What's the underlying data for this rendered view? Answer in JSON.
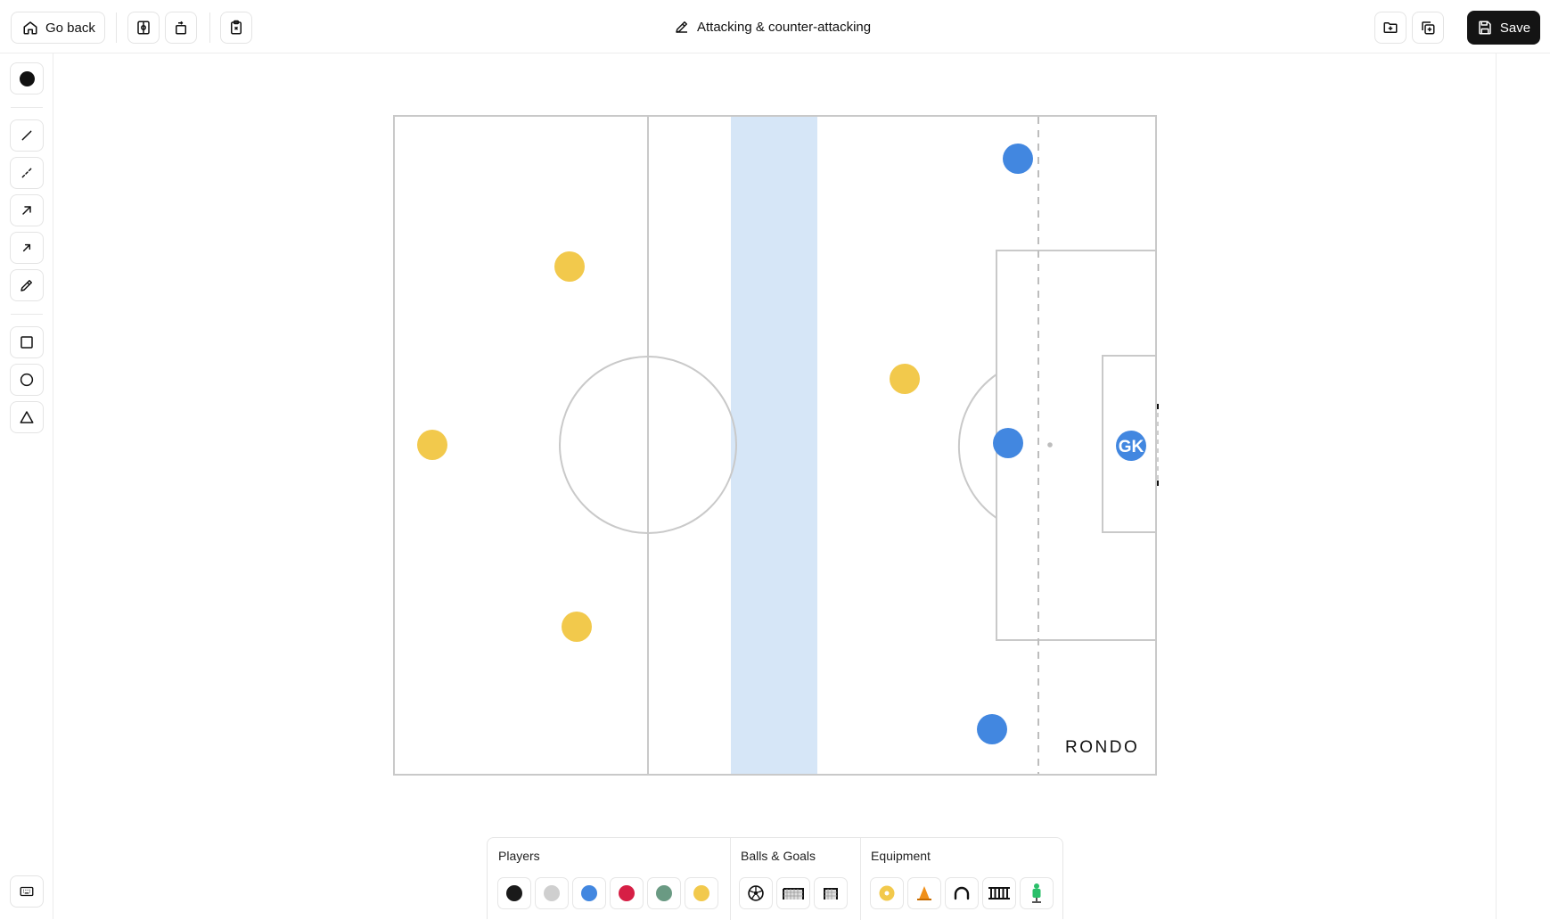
{
  "header": {
    "go_back_label": "Go back",
    "title": "Attacking & counter-attacking",
    "save_label": "Save"
  },
  "pitch": {
    "logo": "RONDO",
    "goalkeeper_label": "GK",
    "colors": {
      "team_yellow": "#f2c94c",
      "team_blue": "#4287e0",
      "zone_highlight": "#d6e6f7",
      "lines": "#c9c9c9"
    }
  },
  "palette": {
    "players_label": "Players",
    "balls_goals_label": "Balls & Goals",
    "equipment_label": "Equipment",
    "player_colors": [
      "#1a1a1a",
      "#cfcfcf",
      "#4287e0",
      "#d61f45",
      "#6a9a83",
      "#f2c94c"
    ]
  }
}
